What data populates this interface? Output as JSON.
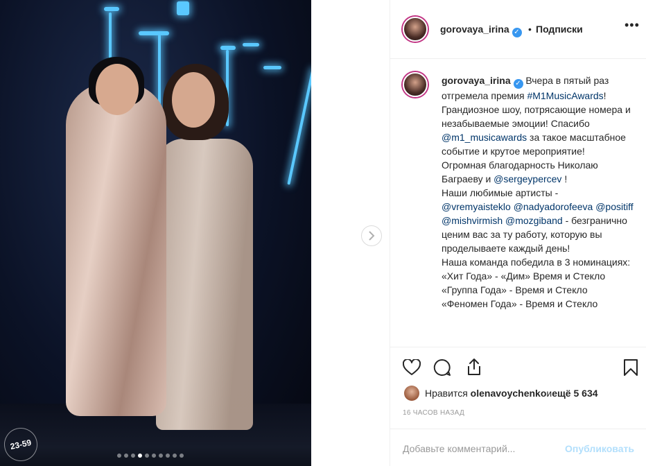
{
  "post": {
    "photo_seal_text": "23-59",
    "carousel_dots": 10,
    "carousel_active_index": 3
  },
  "header": {
    "username": "gorovaya_irina",
    "verified_mark": "✓",
    "separator": "•",
    "follow_label": "Подписки",
    "more_icon": "•••"
  },
  "caption": {
    "username": "gorovaya_irina",
    "segments": [
      {
        "t": "Вчера в пятый раз отгремела премия ",
        "link": false
      },
      {
        "t": "#M1MusicAwards",
        "link": true
      },
      {
        "t": "! Грандиозное шоу, потрясающие номера и незабываемые эмоции! Спасибо ",
        "link": false
      },
      {
        "t": "@m1_musicawards",
        "link": true
      },
      {
        "t": " за такое масштабное событие и крутое мероприятие!",
        "link": false
      },
      {
        "br": true
      },
      {
        "t": "Огромная благодарность Николаю Баграеву и ",
        "link": false
      },
      {
        "t": "@sergeypercev",
        "link": true
      },
      {
        "t": " !",
        "link": false
      },
      {
        "br": true
      },
      {
        "t": "Наши любимые артисты -",
        "link": false
      },
      {
        "br": true
      },
      {
        "t": "@vremyaisteklo",
        "link": true
      },
      {
        "t": " ",
        "link": false
      },
      {
        "t": "@nadyadorofeeva",
        "link": true
      },
      {
        "t": " ",
        "link": false
      },
      {
        "t": "@positiff",
        "link": true
      },
      {
        "t": " ",
        "link": false
      },
      {
        "t": "@mishvirmish",
        "link": true
      },
      {
        "t": " ",
        "link": false
      },
      {
        "t": "@mozgiband",
        "link": true
      },
      {
        "t": " - безгранично ценим вас за ту работу, которую вы проделываете каждый день!",
        "link": false
      },
      {
        "br": true
      },
      {
        "t": "Наша команда победила в 3 номинациях:",
        "link": false
      },
      {
        "br": true
      },
      {
        "t": "«Хит Года» - «Дим» Время и Стекло",
        "link": false
      },
      {
        "br": true
      },
      {
        "t": "«Группа Года» - Время и Стекло",
        "link": false
      },
      {
        "br": true
      },
      {
        "t": "«Феномен Года» - Время и Стекло",
        "link": false
      }
    ]
  },
  "actions": {
    "like_icon": "heart-icon",
    "comment_icon": "comment-icon",
    "share_icon": "share-icon",
    "save_icon": "bookmark-icon"
  },
  "likes": {
    "prefix": "Нравится",
    "user": "olenavoychenko",
    "middle": " и ",
    "count": "ещё 5 634"
  },
  "timestamp": "16 ЧАСОВ НАЗАД",
  "comment": {
    "placeholder": "Добавьте комментарий...",
    "publish_label": "Опубликовать"
  },
  "colors": {
    "link": "#003569",
    "verified": "#3897f0",
    "publish_disabled": "#b2dffc",
    "muted": "#999999",
    "border": "#efefef"
  }
}
